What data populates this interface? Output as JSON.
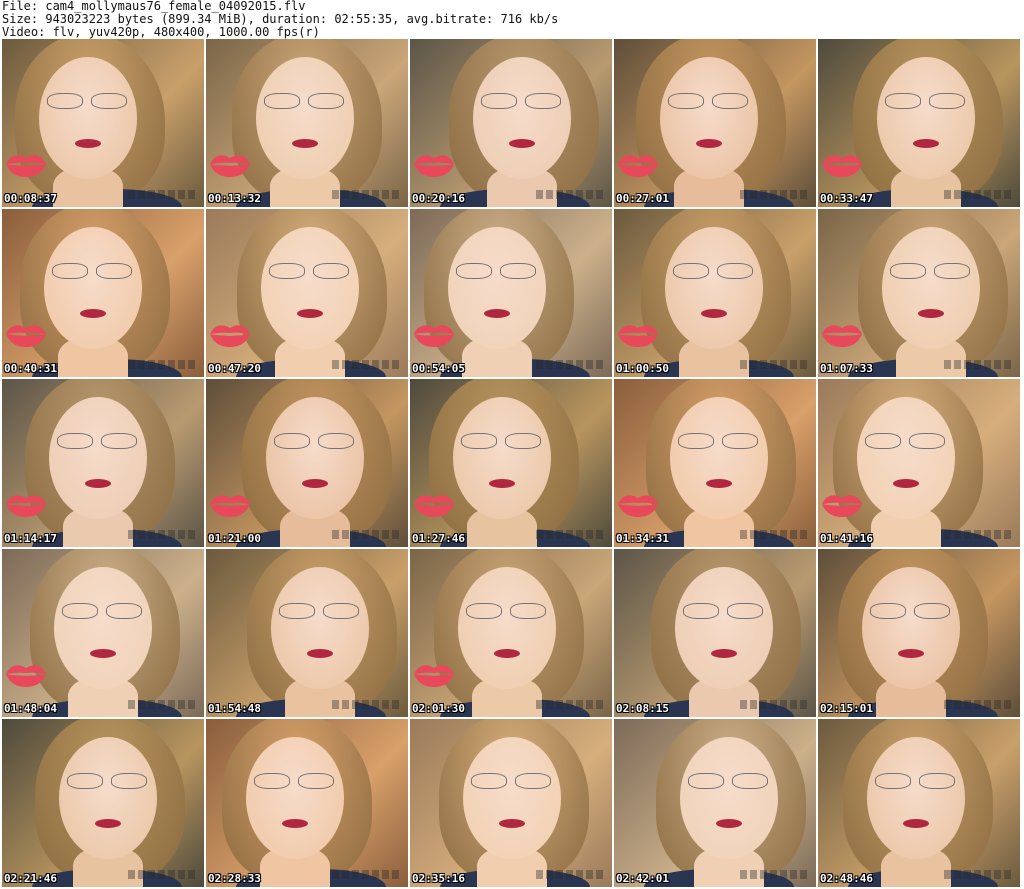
{
  "header": {
    "file_line": "File: cam4_mollymaus76_female_04092015.flv",
    "size_line": "Size: 943023223 bytes (899.34 MiB), duration: 02:55:35, avg.bitrate: 716 kb/s",
    "video_line": "Video: flv, yuv420p, 480x400, 1000.00 fps(r)"
  },
  "thumbnails": [
    {
      "time": "00:08:37",
      "kiss": true
    },
    {
      "time": "00:13:32",
      "kiss": true
    },
    {
      "time": "00:20:16",
      "kiss": true
    },
    {
      "time": "00:27:01",
      "kiss": true
    },
    {
      "time": "00:33:47",
      "kiss": true
    },
    {
      "time": "00:40:31",
      "kiss": true
    },
    {
      "time": "00:47:20",
      "kiss": true
    },
    {
      "time": "00:54:05",
      "kiss": true
    },
    {
      "time": "01:00:50",
      "kiss": true
    },
    {
      "time": "01:07:33",
      "kiss": true
    },
    {
      "time": "01:14:17",
      "kiss": true
    },
    {
      "time": "01:21:00",
      "kiss": true
    },
    {
      "time": "01:27:46",
      "kiss": true
    },
    {
      "time": "01:34:31",
      "kiss": true
    },
    {
      "time": "01:41:16",
      "kiss": true
    },
    {
      "time": "01:48:04",
      "kiss": true
    },
    {
      "time": "01:54:48",
      "kiss": false
    },
    {
      "time": "02:01:30",
      "kiss": true
    },
    {
      "time": "02:08:15",
      "kiss": false
    },
    {
      "time": "02:15:01",
      "kiss": false
    },
    {
      "time": "02:21:46",
      "kiss": false
    },
    {
      "time": "02:28:33",
      "kiss": false
    },
    {
      "time": "02:35:16",
      "kiss": false
    },
    {
      "time": "02:42:01",
      "kiss": false
    },
    {
      "time": "02:48:46",
      "kiss": false
    }
  ],
  "colors": {
    "kiss": "#e8485a",
    "lips": "#b0283f",
    "shirt": "#2a3552"
  }
}
